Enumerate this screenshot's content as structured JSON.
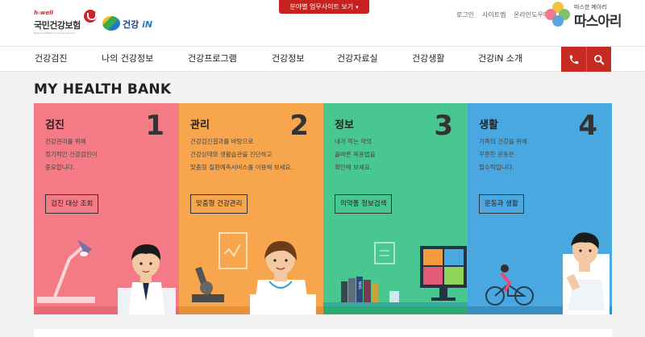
{
  "header": {
    "sites_button": "분야별 업무사이트 보기",
    "nhis_logo": {
      "tag": "h-well",
      "name": "국민건강보험",
      "sub": "National Health Insurance Service"
    },
    "in_logo": {
      "text": "건강",
      "accent": "iN"
    },
    "util": {
      "login": "로그인",
      "sitemap": "사이트맵",
      "online": "온라인도우미"
    },
    "warm_logo": {
      "tag": "따스한 메아리",
      "big": "따스아리"
    }
  },
  "nav": {
    "items": [
      "건강검진",
      "나의 건강정보",
      "건강프로그램",
      "건강정보",
      "건강자료실",
      "건강생활",
      "건강iN 소개"
    ],
    "phone_icon": "phone-icon",
    "search_icon": "search-icon"
  },
  "section": {
    "title": "MY HEALTH BANK",
    "cards": [
      {
        "title": "검진",
        "num": "1",
        "desc": "건강관리를 위해\n정기적인 건강검진이\n중요합니다.",
        "cta": "검진 대상 조회",
        "color": "#f47b86"
      },
      {
        "title": "관리",
        "num": "2",
        "desc": "건강검진결과를 바탕으로\n건강상태와 생활습관을 진단하고\n맞춤형 질환예측서비스를 이용해 보세요.",
        "cta": "맞춤형 건강관리",
        "color": "#f8a64d"
      },
      {
        "title": "정보",
        "num": "3",
        "desc": "내가 먹는 약의\n올바른 복용법을\n확인해 보세요.",
        "cta": "의약품 정보검색",
        "color": "#48c790"
      },
      {
        "title": "생활",
        "num": "4",
        "desc": "가족의 건강을 위해\n꾸준한 운동은\n필수적입니다.",
        "cta": "운동과 생활",
        "color": "#4aa8e0"
      }
    ],
    "book_spines": [
      "NHIS",
      "NHIS"
    ]
  }
}
